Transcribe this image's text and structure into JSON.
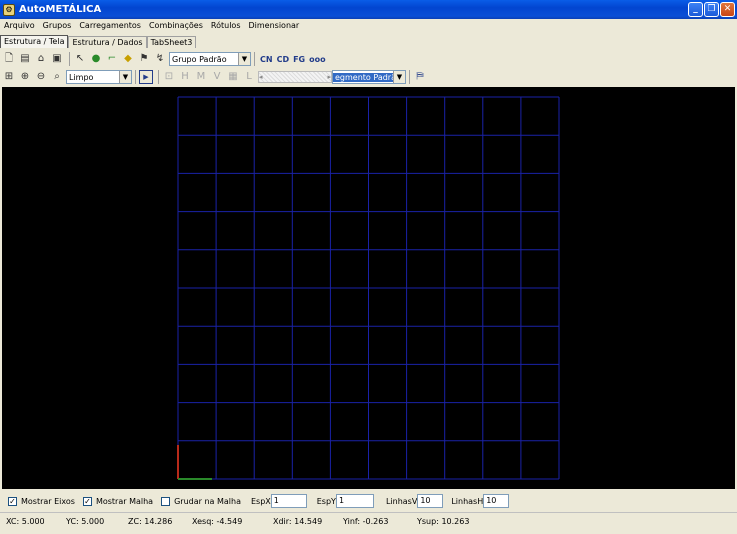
{
  "window": {
    "title": "AutoMETÁLICA",
    "icon_name": "app-icon"
  },
  "menu": [
    {
      "label": "Arquivo"
    },
    {
      "label": "Grupos"
    },
    {
      "label": "Carregamentos"
    },
    {
      "label": "Combinações"
    },
    {
      "label": "Rótulos"
    },
    {
      "label": "Dimensionar"
    }
  ],
  "tabs": [
    {
      "label": "Estrutura / Tela",
      "active": true
    },
    {
      "label": "Estrutura / Dados",
      "active": false
    },
    {
      "label": "TabSheet3",
      "active": false
    }
  ],
  "toolbar1": {
    "group_select": "Grupo Padrão",
    "buttons": [
      "new-icon",
      "save-as-icon",
      "open-icon",
      "save-icon",
      "pointer-icon",
      "node-icon",
      "bar-icon",
      "point-icon",
      "support-icon",
      "load-icon"
    ],
    "text_buttons": [
      "CN",
      "CD",
      "FG",
      "ooo"
    ]
  },
  "toolbar2": {
    "zoom_buttons": [
      "zoom-extents-icon",
      "zoom-in-icon",
      "zoom-out-icon",
      "zoom-window-icon"
    ],
    "view_select": "Limpo",
    "segment_select": "egmento Padrão"
  },
  "canvas": {
    "background": "#000000",
    "grid_color": "#1a22a8",
    "grid_cols": 10,
    "grid_rows": 10
  },
  "options": {
    "show_axes_label": "Mostrar Eixos",
    "show_axes_checked": true,
    "show_mesh_label": "Mostrar Malha",
    "show_mesh_checked": true,
    "snap_mesh_label": "Grudar na Malha",
    "snap_mesh_checked": false,
    "espx_label": "EspX",
    "espx_value": "1",
    "espy_label": "EspY",
    "espy_value": "1",
    "linhasv_label": "LinhasV",
    "linhasv_value": "10",
    "linhash_label": "LinhasH",
    "linhash_value": "10"
  },
  "status": {
    "xc": "XC: 5.000",
    "yc": "YC: 5.000",
    "zc": "ZC: 14.286",
    "xesq": "Xesq: -4.549",
    "xdir": "Xdir: 14.549",
    "yinf": "Yinf: -0.263",
    "ysup": "Ysup: 10.263"
  }
}
